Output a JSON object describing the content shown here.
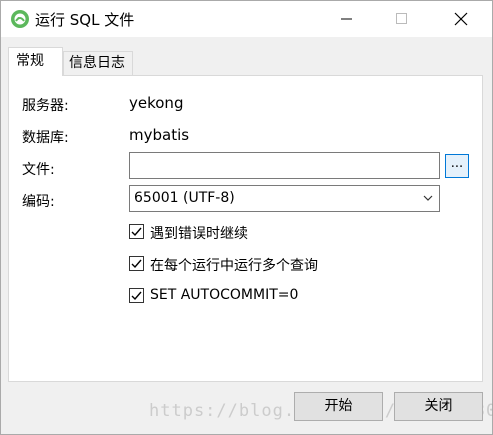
{
  "window": {
    "title": "运行 SQL 文件",
    "icon": "green-elephant-app-icon",
    "controls": [
      "minimize-icon",
      "maximize-icon",
      "close-icon"
    ]
  },
  "tabs": [
    {
      "label": "常规",
      "active": true
    },
    {
      "label": "信息日志",
      "active": false
    }
  ],
  "form": {
    "server_label": "服务器:",
    "server_value": "yekong",
    "database_label": "数据库:",
    "database_value": "mybatis",
    "file_label": "文件:",
    "file_value": "",
    "browse_label": "...",
    "encoding_label": "编码:",
    "encoding_value": "65001 (UTF-8)"
  },
  "options": [
    {
      "label": "遇到错误时继续",
      "checked": true
    },
    {
      "label": "在每个运行中运行多个查询",
      "checked": true
    },
    {
      "label": "SET AUTOCOMMIT=0",
      "checked": true
    }
  ],
  "buttons": {
    "start": "开始",
    "close": "关闭"
  },
  "watermark": "https://blog.csdn.net/qq_23133071",
  "colors": {
    "accent": "#0078d7",
    "app_icon": "#5cb85c"
  }
}
